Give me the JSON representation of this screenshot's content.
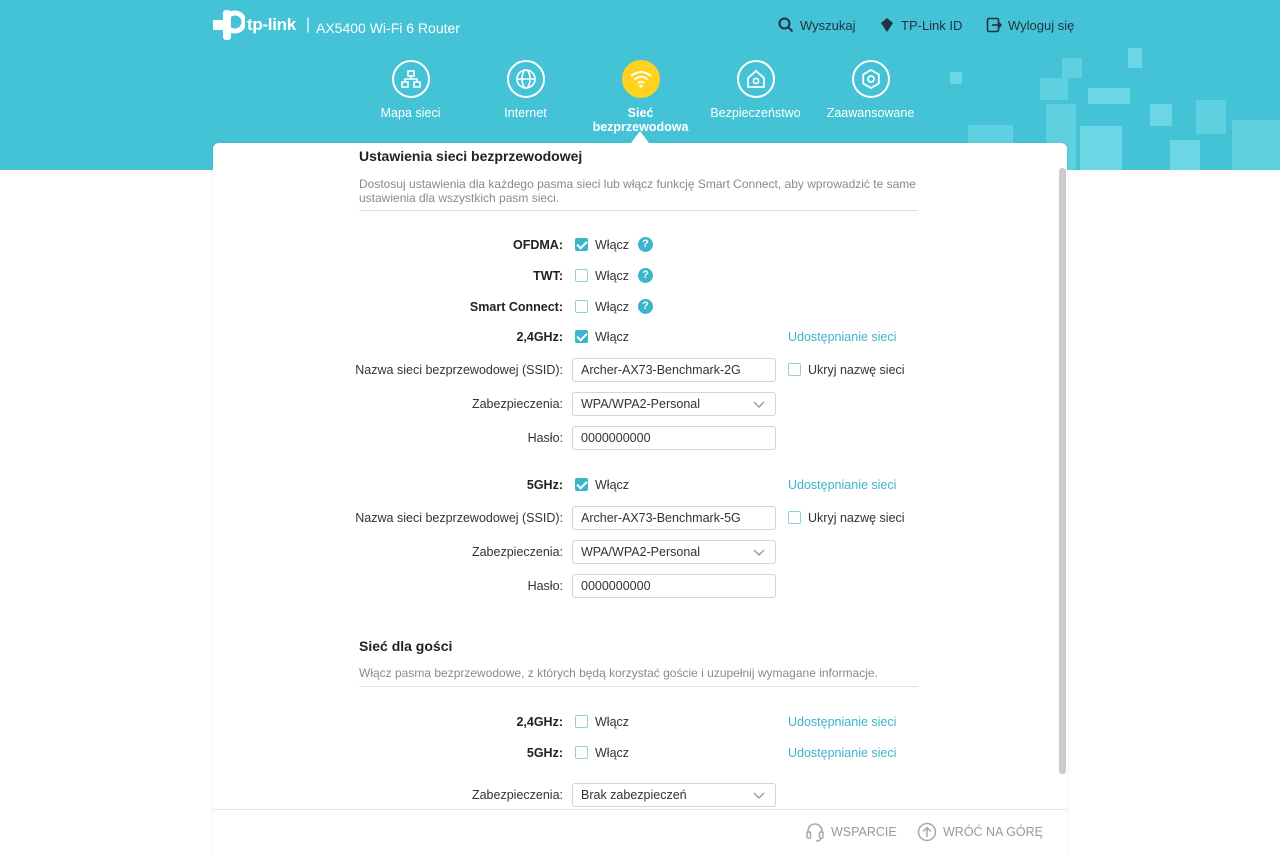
{
  "header": {
    "brand": "tp-link",
    "separator": "|",
    "model": "AX5400 Wi-Fi 6 Router",
    "search_label": "Wyszukaj",
    "tplink_id_label": "TP-Link ID",
    "logout_label": "Wyloguj się"
  },
  "nav": {
    "items": [
      {
        "label": "Mapa sieci",
        "icon": "network-map-icon"
      },
      {
        "label": "Internet",
        "icon": "globe-icon"
      },
      {
        "label": "Sieć\nbezprzewodowa",
        "icon": "wifi-icon",
        "active": true
      },
      {
        "label": "Bezpieczeństwo",
        "icon": "home-security-icon"
      },
      {
        "label": "Zaawansowane",
        "icon": "gear-icon"
      }
    ]
  },
  "wireless": {
    "title": "Ustawienia sieci bezprzewodowej",
    "description": "Dostosuj ustawienia dla każdego pasma sieci lub włącz funkcję Smart Connect, aby wprowadzić te same ustawienia dla wszystkich pasm sieci.",
    "enable_label": "Włącz",
    "share_label": "Udostępnianie sieci",
    "hide_ssid_label": "Ukryj nazwę sieci",
    "ofdma_label": "OFDMA:",
    "ofdma_checked": true,
    "twt_label": "TWT:",
    "twt_checked": false,
    "smart_connect_label": "Smart Connect:",
    "smart_connect_checked": false,
    "ssid_label": "Nazwa sieci bezprzewodowej (SSID):",
    "security_label": "Zabezpieczenia:",
    "password_label": "Hasło:",
    "band_24": {
      "label": "2,4GHz:",
      "enabled": true,
      "ssid": "Archer-AX73-Benchmark-2G",
      "hide_ssid": false,
      "security": "WPA/WPA2-Personal",
      "password": "0000000000"
    },
    "band_5": {
      "label": "5GHz:",
      "enabled": true,
      "ssid": "Archer-AX73-Benchmark-5G",
      "hide_ssid": false,
      "security": "WPA/WPA2-Personal",
      "password": "0000000000"
    }
  },
  "guest": {
    "title": "Sieć dla gości",
    "description": "Włącz pasma bezprzewodowe, z których będą korzystać goście i uzupełnij wymagane informacje.",
    "band_24_label": "2,4GHz:",
    "band_24_enabled": false,
    "band_5_label": "5GHz:",
    "band_5_enabled": false,
    "security_label": "Zabezpieczenia:",
    "security": "Brak zabezpieczeń"
  },
  "footer": {
    "support_label": "WSPARCIE",
    "back_to_top_label": "WRÓĆ NA GÓRĘ"
  },
  "colors": {
    "header_bg": "#45c3d6",
    "accent": "#3ab5c9",
    "active_nav": "#ffd21f"
  }
}
